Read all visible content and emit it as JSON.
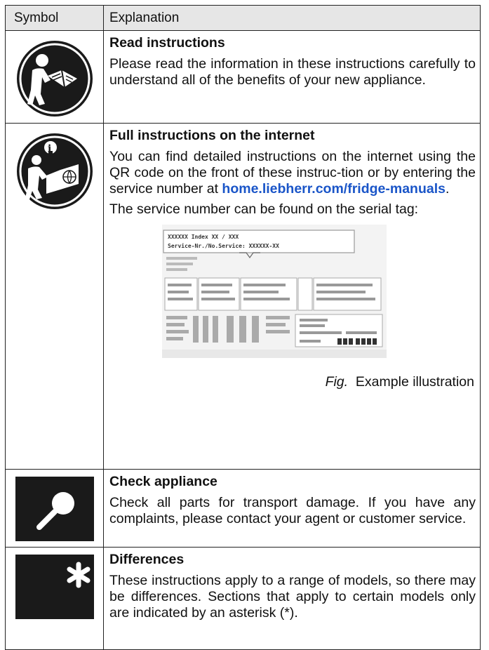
{
  "header": {
    "symbol": "Symbol",
    "explanation": "Explanation"
  },
  "rows": [
    {
      "icon": "read-instructions-icon",
      "title": "Read instructions",
      "text": "Please read the information in these instructions carefully to understand all of the benefits of your new appliance."
    },
    {
      "icon": "internet-instructions-icon",
      "title": "Full instructions on the internet",
      "text_before": "You can find detailed instructions on the internet using the QR code on the front of these instruc-tion or by entering the service number at ",
      "link": "home.liebherr.com/fridge-manuals",
      "text_after": ".",
      "text2": "The service number can be found on the serial tag:",
      "figure": {
        "tag_line1": "XXXXXX Index XX / XXX",
        "tag_line2": "Service-Nr./No.Service: XXXXXX-XX",
        "caption_fig": "Fig.",
        "caption": "Example illustration"
      }
    },
    {
      "icon": "magnifier-icon",
      "title": "Check appliance",
      "text": "Check all parts for transport damage. If you have any complaints, please contact your agent or customer service."
    },
    {
      "icon": "asterisk-icon",
      "title": "Differences",
      "text": "These instructions apply to a range of models, so there may be differences. Sections that apply to certain models only are indicated by an asterisk (*)."
    }
  ],
  "colors": {
    "link": "#1a55c8",
    "icon_bg": "#1a1a1a",
    "header_bg": "#e6e6e6"
  }
}
